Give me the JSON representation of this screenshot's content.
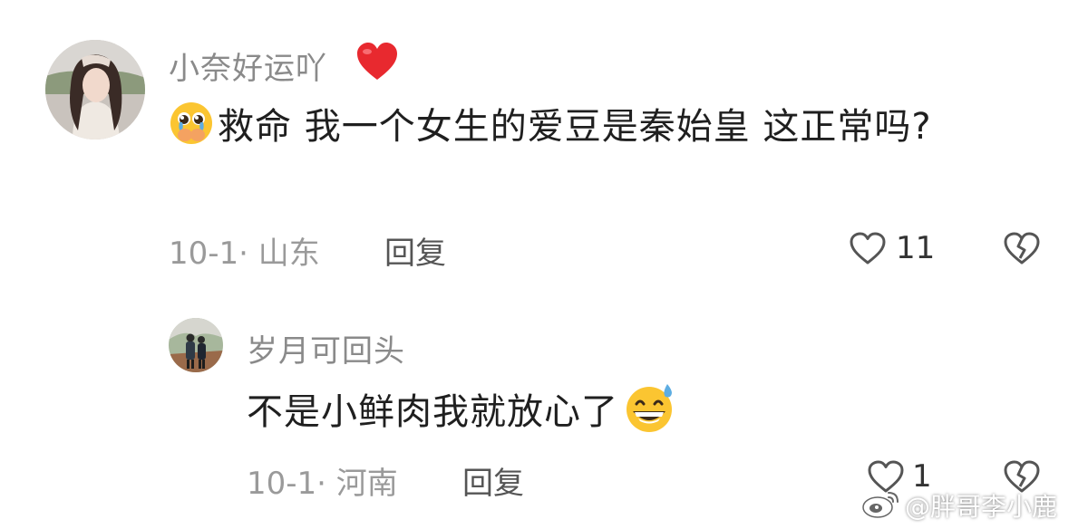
{
  "comments": [
    {
      "username": "小奈好运吖",
      "username_emoji": "heart-emoji",
      "text": "救命  我一个女生的爱豆是秦始皇 这正常吗?",
      "leading_emoji": "pleading-face-emoji",
      "date_location": "10-1· 山东",
      "reply_label": "回复",
      "like_count": "11"
    },
    {
      "username": "岁月可回头",
      "text": "不是小鲜肉我就放心了",
      "trailing_emoji": "grinning-sweat-emoji",
      "date_location": "10-1· 河南",
      "reply_label": "回复",
      "like_count": "1"
    }
  ],
  "watermark": "@胖哥李小鹿",
  "colors": {
    "heart": "#e8292f",
    "meta_gray": "#9a9a9a",
    "username_gray": "#8a8a8a"
  }
}
